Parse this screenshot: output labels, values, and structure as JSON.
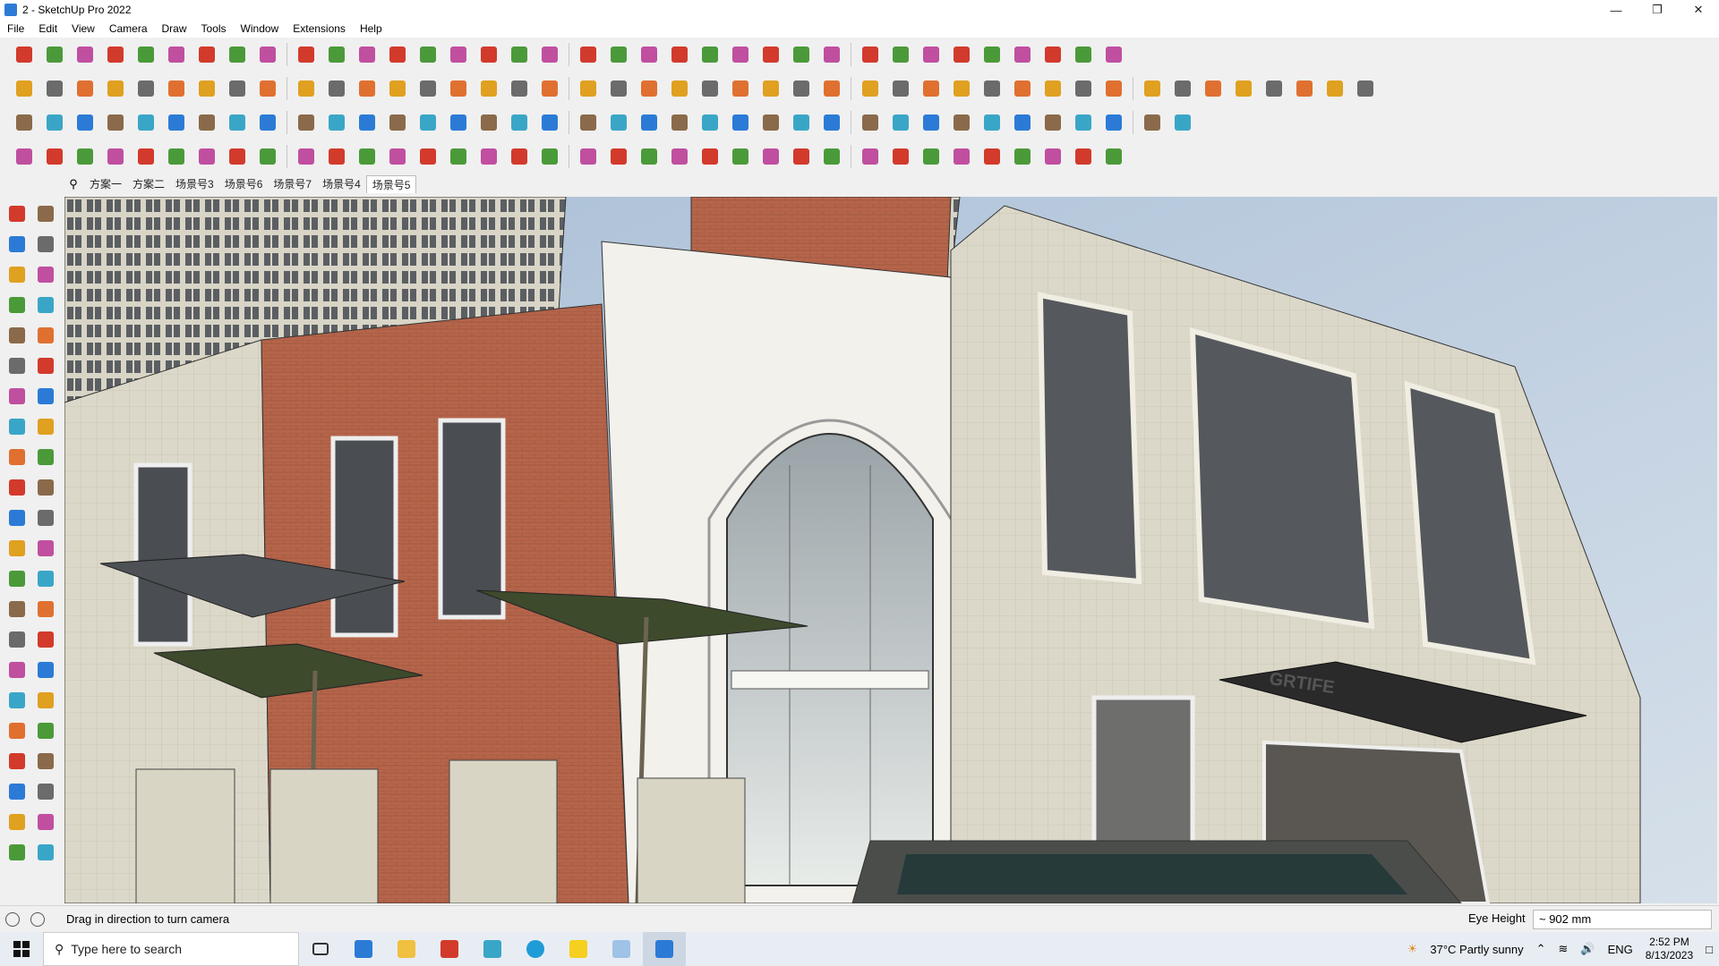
{
  "window": {
    "title": "2 - SketchUp Pro 2022",
    "controls": [
      "minimize-icon",
      "restore-icon",
      "close-icon"
    ]
  },
  "menu": [
    "File",
    "Edit",
    "View",
    "Camera",
    "Draw",
    "Tools",
    "Window",
    "Extensions",
    "Help"
  ],
  "scene_tabs": [
    "方案一",
    "方案二",
    "场景号3",
    "场景号6",
    "场景号7",
    "场景号4",
    "场景号5"
  ],
  "active_scene_index": 6,
  "status": {
    "message": "Drag in direction to turn camera",
    "measure_label": "Eye Height",
    "measure_value": "~ 902 mm"
  },
  "taskbar": {
    "search_placeholder": "Type here to search",
    "weather": "37°C  Partly sunny",
    "language": "ENG",
    "time": "2:52 PM",
    "date": "8/13/2023"
  },
  "colors": {
    "chrome": "#f0f0f0",
    "sky": "#b9cce0",
    "brick": "#b5654a",
    "stone": "#d9d6c8",
    "white_stone": "#f2f1ec",
    "umbrella": "#3d4a2c",
    "accent_red": "#d23a2c",
    "accent_blue": "#2b7bd6"
  },
  "building_sign": "GRTIFE"
}
